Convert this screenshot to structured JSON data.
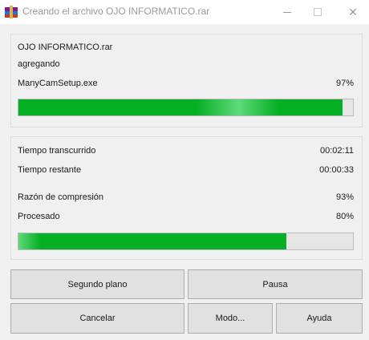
{
  "window": {
    "title": "Creando el archivo OJO INFORMATICO.rar",
    "icon": "winrar-books-icon",
    "controls": {
      "minimize": "—",
      "maximize": "□",
      "close": "✕"
    }
  },
  "archive": {
    "name": "OJO INFORMATICO.rar",
    "action": "agregando",
    "current_file": "ManyCamSetup.exe",
    "file_percent_label": "97%",
    "file_progress": 0.97
  },
  "stats": {
    "elapsed_label": "Tiempo transcurrido",
    "elapsed_value": "00:02:11",
    "remaining_label": "Tiempo restante",
    "remaining_value": "00:00:33",
    "ratio_label": "Razón de compresión",
    "ratio_value": "93%",
    "processed_label": "Procesado",
    "processed_value": "80%",
    "total_progress": 0.8
  },
  "buttons": {
    "background": "Segundo plano",
    "pause": "Pausa",
    "cancel": "Cancelar",
    "mode": "Modo...",
    "help": "Ayuda"
  },
  "colors": {
    "progress_fill": "#06b025",
    "progress_track": "#e6e6e6"
  }
}
